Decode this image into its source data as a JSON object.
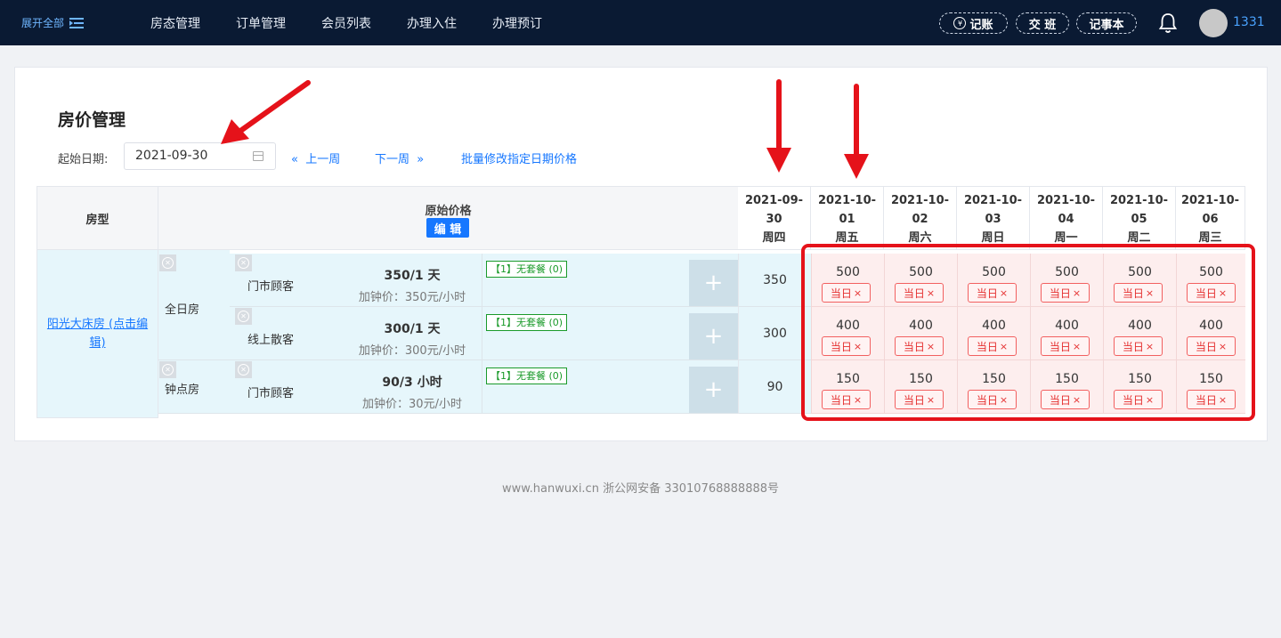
{
  "topbar": {
    "expand_label": "展开全部",
    "nav": [
      "房态管理",
      "订单管理",
      "会员列表",
      "办理入住",
      "办理预订"
    ],
    "buttons": {
      "bookkeeping": "记账",
      "shift": "交 班",
      "notes": "记事本"
    },
    "user": "1331"
  },
  "page": {
    "title": "房价管理",
    "start_date_label": "起始日期:",
    "start_date_value": "2021-09-30",
    "prev_week": "上一周",
    "next_week": "下一周",
    "batch_edit": "批量修改指定日期价格"
  },
  "table": {
    "header_room_type": "房型",
    "header_original_price": "原始价格",
    "edit_button": "编 辑",
    "days": [
      {
        "date_top": "2021-09-",
        "date_bottom": "30",
        "weekday": "周四"
      },
      {
        "date_top": "2021-10-",
        "date_bottom": "01",
        "weekday": "周五"
      },
      {
        "date_top": "2021-10-",
        "date_bottom": "02",
        "weekday": "周六"
      },
      {
        "date_top": "2021-10-",
        "date_bottom": "03",
        "weekday": "周日"
      },
      {
        "date_top": "2021-10-",
        "date_bottom": "04",
        "weekday": "周一"
      },
      {
        "date_top": "2021-10-",
        "date_bottom": "05",
        "weekday": "周二"
      },
      {
        "date_top": "2021-10-",
        "date_bottom": "06",
        "weekday": "周三"
      }
    ],
    "room_type_link": "阳光大床房 (点击编辑)",
    "sub_types": [
      "全日房",
      "钟点房"
    ],
    "rows": [
      {
        "customer": "门市顾客",
        "price": "350/1 天",
        "extra": "加钟价：350元/小时",
        "package": "【1】无套餐 (0)",
        "original": "350",
        "day_values": [
          "500",
          "500",
          "500",
          "500",
          "500",
          "500"
        ]
      },
      {
        "customer": "线上散客",
        "price": "300/1 天",
        "extra": "加钟价：300元/小时",
        "package": "【1】无套餐 (0)",
        "original": "300",
        "day_values": [
          "400",
          "400",
          "400",
          "400",
          "400",
          "400"
        ]
      },
      {
        "customer": "门市顾客",
        "price": "90/3 小时",
        "extra": "加钟价：30元/小时",
        "package": "【1】无套餐 (0)",
        "original": "90",
        "day_values": [
          "150",
          "150",
          "150",
          "150",
          "150",
          "150"
        ]
      }
    ],
    "tag_label": "当日",
    "tag_close": "×",
    "plus": "+"
  },
  "footer": "www.hanwuxi.cn  浙公网安备 33010768888888号",
  "colors": {
    "topbar": "#0a1a33",
    "accent": "#1677ff",
    "highlight": "#e5121a",
    "package_green": "#1a9a2a"
  }
}
